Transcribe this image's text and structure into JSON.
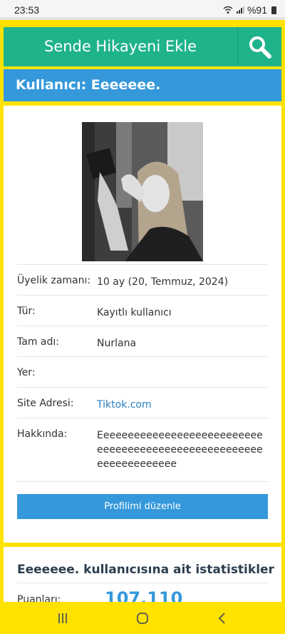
{
  "status_bar": {
    "time": "23:53",
    "battery_text": "%91"
  },
  "header": {
    "title": "Sende Hikayeni Ekle"
  },
  "banner": {
    "title": "Kullanıcı: Eeeeeee."
  },
  "profile": {
    "rows": [
      {
        "label": "Üyelik zamanı:",
        "value": "10 ay (20, Temmuz, 2024)"
      },
      {
        "label": "Tür:",
        "value": "Kayıtlı kullanıcı"
      },
      {
        "label": "Tam adı:",
        "value": "Nurlana"
      },
      {
        "label": "Yer:",
        "value": ""
      },
      {
        "label": "Site Adresi:",
        "value": "Tiktok.com"
      },
      {
        "label": "Hakkında:",
        "value": "Eeeeeeeeeeeeeeeeeeeeeeeeeeeeeeeeeeeeeeeeeeeeeeeeeeeeeeeeeeeeeeeeeee"
      }
    ],
    "edit_button": "Profilimi düzenle"
  },
  "stats": {
    "title": "Eeeeeee. kullanıcısına ait istatistikler",
    "points_label": "Puanları:",
    "points_value": "107.110"
  },
  "colors": {
    "accent_yellow": "#ffe200",
    "header_green": "#1fb38b",
    "banner_blue": "#3498db",
    "link_blue": "#2a7fc0"
  }
}
